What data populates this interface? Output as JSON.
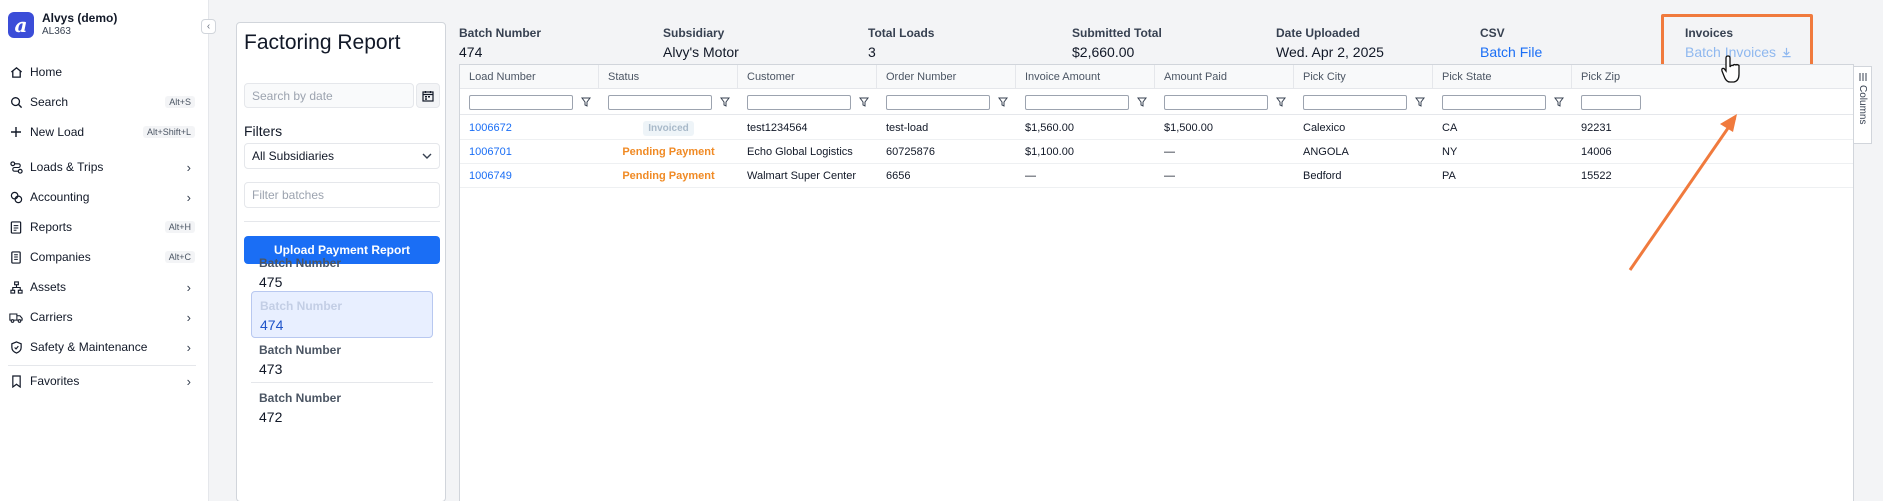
{
  "org": {
    "name": "Alvys (demo)",
    "code": "AL363",
    "logo_letter": "a"
  },
  "nav": {
    "collapse_icon": "chevron-left",
    "items": [
      {
        "label": "Home",
        "icon": "home-icon"
      },
      {
        "label": "Search",
        "icon": "search-icon",
        "shortcut": "Alt+S"
      },
      {
        "label": "New Load",
        "icon": "plus-icon",
        "shortcut": "Alt+Shift+L"
      },
      {
        "label": "Loads & Trips",
        "icon": "route-icon"
      },
      {
        "label": "Accounting",
        "icon": "coins-icon"
      },
      {
        "label": "Reports",
        "icon": "report-icon",
        "shortcut": "Alt+H"
      },
      {
        "label": "Companies",
        "icon": "building-icon",
        "shortcut": "Alt+C"
      },
      {
        "label": "Assets",
        "icon": "network-icon"
      },
      {
        "label": "Carriers",
        "icon": "truck-icon"
      },
      {
        "label": "Safety & Maintenance",
        "icon": "shield-icon"
      },
      {
        "label": "Favorites",
        "icon": "bookmark-icon"
      }
    ]
  },
  "panel": {
    "title": "Factoring Report",
    "search_placeholder": "Search by date",
    "filters_label": "Filters",
    "subsidiary_select": "All Subsidiaries",
    "filter_batches_placeholder": "Filter batches",
    "upload_button": "Upload Payment Report",
    "batch_label": "Batch Number",
    "batches": [
      "475",
      "474",
      "473",
      "472"
    ],
    "selected_batch": "474"
  },
  "summary": {
    "batch_number": {
      "label": "Batch Number",
      "value": "474"
    },
    "subsidiary": {
      "label": "Subsidiary",
      "value": "Alvy's Motor"
    },
    "total_loads": {
      "label": "Total Loads",
      "value": "3"
    },
    "submitted_total": {
      "label": "Submitted Total",
      "value": "$2,660.00"
    },
    "date_uploaded": {
      "label": "Date Uploaded",
      "value": "Wed. Apr 2, 2025"
    },
    "csv": {
      "label": "CSV",
      "value": "Batch File"
    },
    "invoices": {
      "label": "Invoices",
      "value": "Batch Invoices"
    }
  },
  "grid": {
    "columns": [
      "Load Number",
      "Status",
      "Customer",
      "Order Number",
      "Invoice Amount",
      "Amount Paid",
      "Pick City",
      "Pick State",
      "Pick Zip"
    ],
    "rows": [
      [
        "1006672",
        "Invoiced",
        "test1234564",
        "test-load",
        "$1,560.00",
        "$1,500.00",
        "Calexico",
        "CA",
        "92231"
      ],
      [
        "1006701",
        "Pending Payment",
        "Echo Global Logistics",
        "60725876",
        "$1,100.00",
        "—",
        "ANGOLA",
        "NY",
        "14006"
      ],
      [
        "1006749",
        "Pending Payment",
        "Walmart Super Center",
        "6656",
        "—",
        "—",
        "Bedford",
        "PA",
        "15522"
      ]
    ],
    "columns_tab": "Columns"
  },
  "colors": {
    "accent": "#1a6ef5",
    "pending": "#f08a24",
    "annotation": "#f07a3d"
  }
}
